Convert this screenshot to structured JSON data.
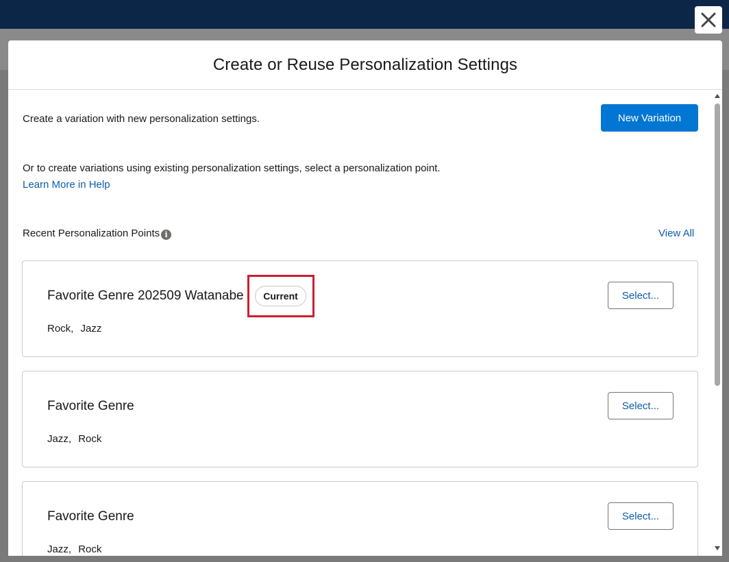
{
  "modal": {
    "title": "Create or Reuse Personalization Settings",
    "intro": "Create a variation with new personalization settings.",
    "new_variation_label": "New Variation",
    "reuse_text": "Or to create variations using existing personalization settings, select a personalization point.",
    "help_link": "Learn More in Help",
    "recent_label": "Recent Personalization Points",
    "info_icon_glyph": "i",
    "view_all": "View All",
    "close_glyph": "✕",
    "cards": [
      {
        "title": "Favorite Genre 202509 Watanabe",
        "badge": "Current",
        "tags": [
          "Rock,",
          "Jazz"
        ],
        "select_label": "Select..."
      },
      {
        "title": "Favorite Genre",
        "tags": [
          "Jazz,",
          "Rock"
        ],
        "select_label": "Select..."
      },
      {
        "title": "Favorite Genre",
        "tags": [
          "Jazz,",
          "Rock"
        ],
        "select_label": "Select..."
      }
    ]
  },
  "colors": {
    "brand": "#0176d3",
    "link": "#0b5cab",
    "highlight": "#c8202f",
    "topbar": "#0b2646"
  }
}
